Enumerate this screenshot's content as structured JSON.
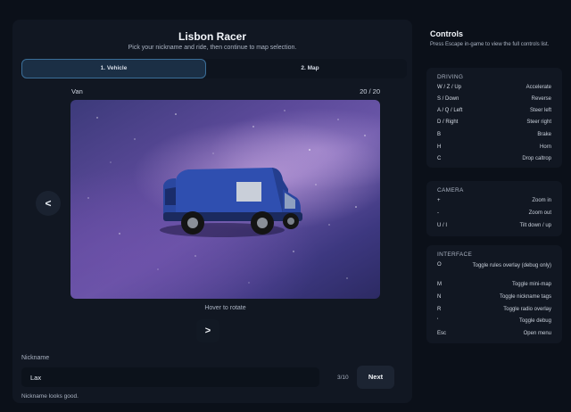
{
  "game": {
    "title": "Lisbon Racer",
    "subtitle": "Pick your nickname and ride, then continue to map selection."
  },
  "tabs": [
    {
      "label": "1. Vehicle",
      "active": true
    },
    {
      "label": "2. Map",
      "active": false
    }
  ],
  "vehicle": {
    "name": "Van",
    "index": "20 / 20",
    "color": "#2f4fb0",
    "prev_label": "<",
    "next_label": ">",
    "hint": "Hover to rotate"
  },
  "nickname": {
    "label": "Nickname",
    "value": "Lax",
    "count": "3/10",
    "status": "Nickname looks good.",
    "next_button": "Next"
  },
  "controls": {
    "title": "Controls",
    "description": "Press Escape in-game to view the full controls list.",
    "sections": [
      {
        "title": "DRIVING",
        "rows": [
          {
            "key": "W / Z / Up",
            "action": "Accelerate"
          },
          {
            "key": "S / Down",
            "action": "Reverse"
          },
          {
            "key": "A / Q / Left",
            "action": "Steer left"
          },
          {
            "key": "D / Right",
            "action": "Steer right"
          },
          {
            "key": "B",
            "action": "Brake"
          },
          {
            "key": "H",
            "action": "Horn"
          },
          {
            "key": "C",
            "action": "Drop caltrop"
          }
        ]
      },
      {
        "title": "CAMERA",
        "rows": [
          {
            "key": "+",
            "action": "Zoom in"
          },
          {
            "key": "-",
            "action": "Zoom out"
          },
          {
            "key": "U / I",
            "action": "Tilt down / up"
          }
        ]
      },
      {
        "title": "INTERFACE",
        "rows": [
          {
            "key": "O",
            "action": "Toggle rules overlay (debug only)"
          },
          {
            "key": "M",
            "action": "Toggle mini-map"
          },
          {
            "key": "N",
            "action": "Toggle nickname tags"
          },
          {
            "key": "R",
            "action": "Toggle radio overlay"
          },
          {
            "key": "'",
            "action": "Toggle debug"
          },
          {
            "key": "Esc",
            "action": "Open menu"
          }
        ]
      }
    ]
  },
  "colors": {
    "accent": "#3b6e98",
    "background": "#0b1019",
    "panel": "#111722"
  }
}
